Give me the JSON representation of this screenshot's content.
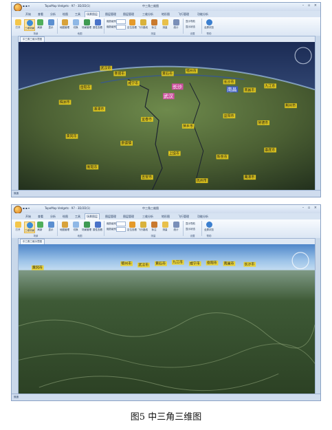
{
  "window": {
    "title_left": "TopoMap Vedgets · 97 - 3D/2D(1)",
    "title_right": "中三角三维图",
    "controls": "– ▫ ×"
  },
  "tabs": [
    "开始",
    "查看",
    "分析",
    "绘图",
    "工具",
    "场景图层",
    "图层管理",
    "图层管理",
    "三维分析",
    "地形图",
    "飞行管理",
    "功能分析"
  ],
  "ribbon": {
    "group1_buttons": [
      "打开",
      "三维场景",
      "刷新",
      "显示"
    ],
    "group1_label": "场景",
    "group2_buttons": [
      "地图管理",
      "切换",
      "场景管理",
      "属性查看"
    ],
    "group2_label": "地图",
    "mini1": "缩放级别",
    "mini2": "缩放级别",
    "group3_buttons": [
      "定位查看",
      "飞行路线",
      "标注",
      "测量",
      "统计"
    ],
    "group3_label": "测量",
    "group4_items": [
      "显示导航",
      "显示状态"
    ],
    "group4_label": "设置",
    "group5_buttons": [
      "全屏浏览"
    ],
    "group5_label": "帮助"
  },
  "views": {
    "doc_tab": "中三角三维示意图",
    "status": "就绪"
  },
  "scene1_labels": [
    "武汉市",
    "咸宁市",
    "黄石市",
    "鄂州市",
    "孝感市",
    "长沙市",
    "南昌市",
    "九江市",
    "岳阳市",
    "株洲市",
    "湘潭市",
    "宜春市",
    "萍乡市",
    "益阳市",
    "常德市",
    "荆州市",
    "黄冈市",
    "景德镇",
    "上饶市",
    "新余市",
    "娄底市",
    "衡阳市",
    "吉安市",
    "抚州市",
    "鹰潭市"
  ],
  "scene1_highlight": [
    "武汉",
    "长沙",
    "南昌"
  ],
  "scene2_labels": [
    "黄冈市",
    "鄂州市",
    "武汉市",
    "黄石市",
    "九江市",
    "咸宁市",
    "岳阳市",
    "南昌市",
    "长沙市"
  ],
  "caption": "图5    中三角三维图",
  "colors": {
    "ribbon_bg": "#dbe6f4",
    "label_yellow": "#f2d21a",
    "label_magenta": "#e04ab0",
    "label_blue": "#3a5bd8",
    "terrain_dark": "#24321e",
    "terrain_light": "#6e8a4c"
  }
}
